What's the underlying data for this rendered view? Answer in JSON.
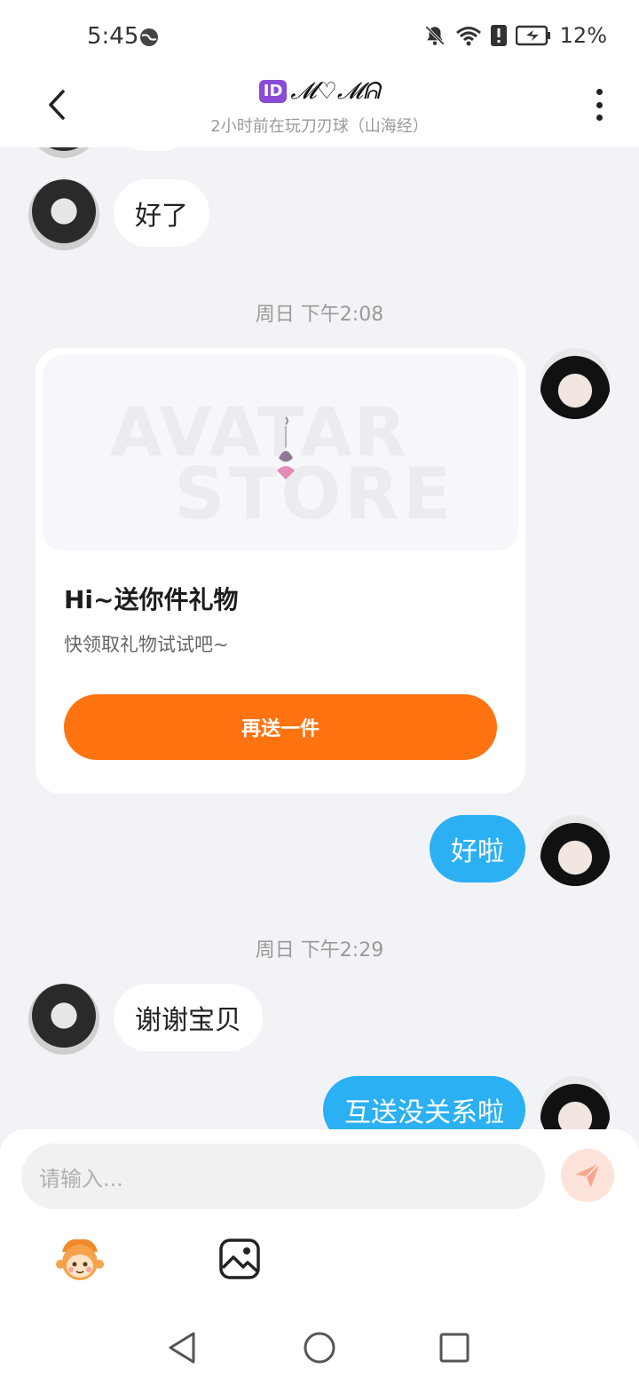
{
  "status_bar": {
    "time": "5:45",
    "battery": "12%",
    "icons": [
      "globe-icon",
      "bell-off-icon",
      "wifi-icon",
      "alert-icon",
      "battery-charging-icon"
    ]
  },
  "header": {
    "id_badge": "ID",
    "title": "𝓜♡𝓜ᕱ",
    "subtitle": "2小时前在玩刀刃球（山海经）",
    "back_icon": "chevron-left-icon",
    "more_icon": "more-vertical-icon"
  },
  "messages": [
    {
      "type": "in",
      "text": "好了"
    },
    {
      "type": "time",
      "text": "周日 下午2:08"
    },
    {
      "type": "gift_card",
      "watermark_1": "AVATAR",
      "watermark_2": "STORE",
      "title": "Hi~送你件礼物",
      "subtitle": "快领取礼物试试吧~",
      "button": "再送一件"
    },
    {
      "type": "out",
      "text": "好啦"
    },
    {
      "type": "time",
      "text": "周日 下午2:29"
    },
    {
      "type": "in",
      "text": "谢谢宝贝"
    },
    {
      "type": "out",
      "text": "互送没关系啦"
    }
  ],
  "input": {
    "placeholder": "请输入...",
    "send_icon": "send-icon"
  },
  "tools": [
    "emoji-sticker-icon",
    "image-icon"
  ],
  "nav": [
    "nav-back-icon",
    "nav-home-icon",
    "nav-recent-icon"
  ],
  "colors": {
    "outgoing_bubble": "#2bb0f3",
    "gift_button": "#ff7311",
    "background": "#f2f3f7"
  }
}
